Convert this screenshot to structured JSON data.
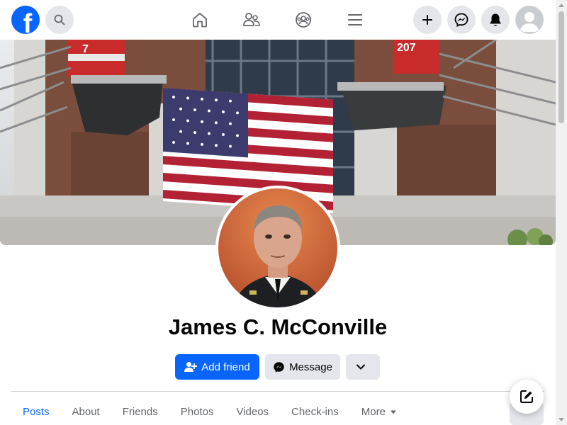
{
  "header": {
    "logo": "f",
    "icons": [
      "search-icon",
      "home-icon",
      "friends-icon",
      "groups-icon",
      "menu-icon",
      "create-icon",
      "messenger-icon",
      "notifications-icon",
      "account-icon"
    ]
  },
  "profile": {
    "name": "James C. McConville"
  },
  "actions": {
    "add_friend_label": "Add friend",
    "message_label": "Message"
  },
  "tabs": [
    {
      "label": "Posts",
      "active": true
    },
    {
      "label": "About"
    },
    {
      "label": "Friends"
    },
    {
      "label": "Photos"
    },
    {
      "label": "Videos"
    },
    {
      "label": "Check-ins"
    },
    {
      "label": "More"
    }
  ],
  "colors": {
    "brand": "#0866ff",
    "button_secondary": "#e4e6eb",
    "text_primary": "#050505",
    "text_secondary": "#65676b"
  }
}
